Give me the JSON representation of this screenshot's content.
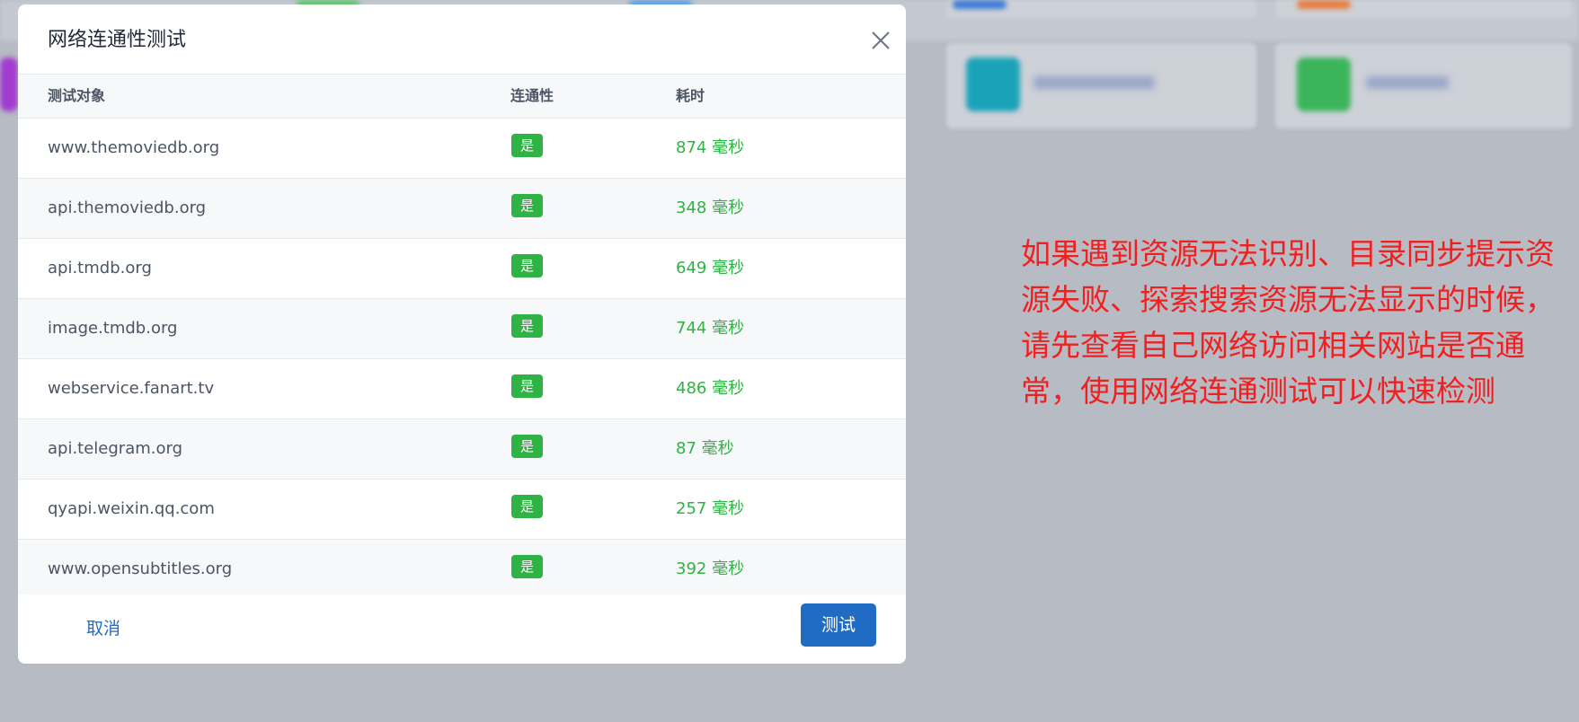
{
  "dialog": {
    "title": "网络连通性测试",
    "columns": {
      "name": "测试对象",
      "connectivity": "连通性",
      "time": "耗时"
    },
    "rows": [
      {
        "name": "www.themoviedb.org",
        "status": "是",
        "time": "874 毫秒"
      },
      {
        "name": "api.themoviedb.org",
        "status": "是",
        "time": "348 毫秒"
      },
      {
        "name": "api.tmdb.org",
        "status": "是",
        "time": "649 毫秒"
      },
      {
        "name": "image.tmdb.org",
        "status": "是",
        "time": "744 毫秒"
      },
      {
        "name": "webservice.fanart.tv",
        "status": "是",
        "time": "486 毫秒"
      },
      {
        "name": "api.telegram.org",
        "status": "是",
        "time": "87 毫秒"
      },
      {
        "name": "qyapi.weixin.qq.com",
        "status": "是",
        "time": "257 毫秒"
      },
      {
        "name": "www.opensubtitles.org",
        "status": "是",
        "time": "392 毫秒"
      }
    ],
    "cancel_label": "取消",
    "test_label": "测试"
  },
  "annotation": {
    "text": "如果遇到资源无法识别、目录同步提示资\n源失败、探索搜索资源无法显示的时候，\n请先查看自己网络访问相关网站是否通\n常，使用网络连通测试可以快速检测"
  },
  "colors": {
    "success": "#2fb344",
    "primary": "#206bc4",
    "annotation": "#f02020",
    "overlay": "#b6bbc4"
  },
  "icons": {
    "close": "close-icon"
  }
}
